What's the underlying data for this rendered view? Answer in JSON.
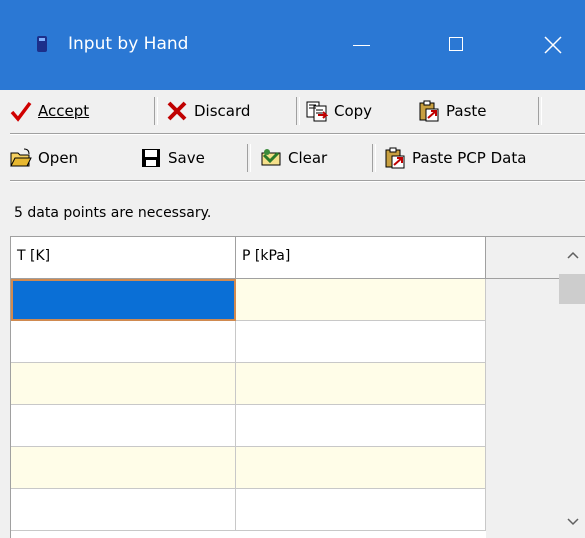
{
  "window": {
    "title": "Input by Hand"
  },
  "toolbar1": {
    "accept": "Accept",
    "discard": "Discard",
    "copy": "Copy",
    "paste": "Paste"
  },
  "toolbar2": {
    "open": "Open",
    "save": "Save",
    "clear": "Clear",
    "paste_pcp": "Paste PCP Data"
  },
  "info_text": "5 data points are necessary.",
  "grid": {
    "columns": [
      "T [K]",
      "P [kPa]"
    ],
    "rows": [
      [
        "",
        ""
      ],
      [
        "",
        ""
      ],
      [
        "",
        ""
      ],
      [
        "",
        ""
      ],
      [
        "",
        ""
      ],
      [
        "",
        ""
      ]
    ]
  },
  "colors": {
    "titlebar": "#2b78d4",
    "alt_row": "#fffde8",
    "selection": "#0a6fd6"
  }
}
